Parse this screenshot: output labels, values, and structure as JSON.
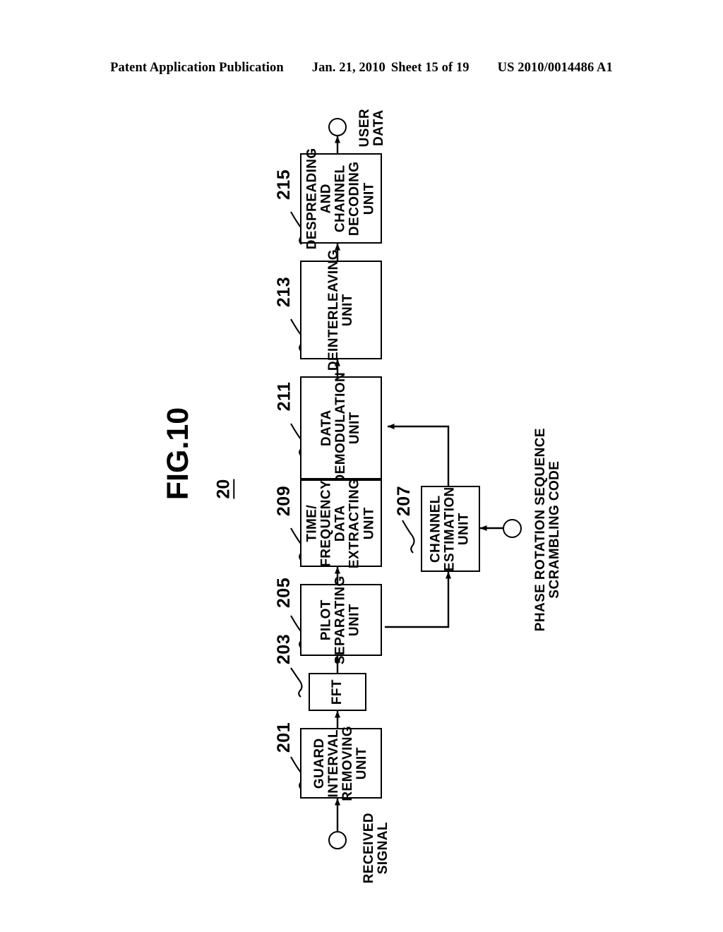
{
  "header": {
    "publication": "Patent Application Publication",
    "date": "Jan. 21, 2010",
    "sheet": "Sheet 15 of 19",
    "docnum": "US 2010/0014486 A1"
  },
  "figure": {
    "title": "FIG.10",
    "system_numeral": "20",
    "blocks": [
      {
        "ref": "201",
        "lines": [
          "GUARD",
          "INTERVAL",
          "REMOVING",
          "UNIT"
        ]
      },
      {
        "ref": "203",
        "lines": [
          "FFT"
        ]
      },
      {
        "ref": "205",
        "lines": [
          "PILOT",
          "SEPARATING",
          "UNIT"
        ]
      },
      {
        "ref": "209",
        "lines": [
          "TIME/",
          "FREQUENCY",
          "DATA",
          "EXTRACTING",
          "UNIT"
        ]
      },
      {
        "ref": "211",
        "lines": [
          "DATA",
          "DEMODULATION",
          "UNIT"
        ]
      },
      {
        "ref": "213",
        "lines": [
          "DEINTERLEAVING",
          "UNIT"
        ]
      },
      {
        "ref": "215",
        "lines": [
          "DESPREADING",
          "AND",
          "CHANNEL",
          "DECODING",
          "UNIT"
        ]
      },
      {
        "ref": "207",
        "lines": [
          "CHANNEL",
          "ESTIMATION",
          "UNIT"
        ]
      }
    ],
    "terminals": [
      {
        "name": "received-signal",
        "lines": [
          "RECEIVED",
          "SIGNAL"
        ]
      },
      {
        "name": "user-data",
        "lines": [
          "USER",
          "DATA"
        ]
      },
      {
        "name": "phase-rotation",
        "lines": [
          "PHASE ROTATION SEQUENCE",
          "SCRAMBLING CODE"
        ]
      }
    ]
  }
}
